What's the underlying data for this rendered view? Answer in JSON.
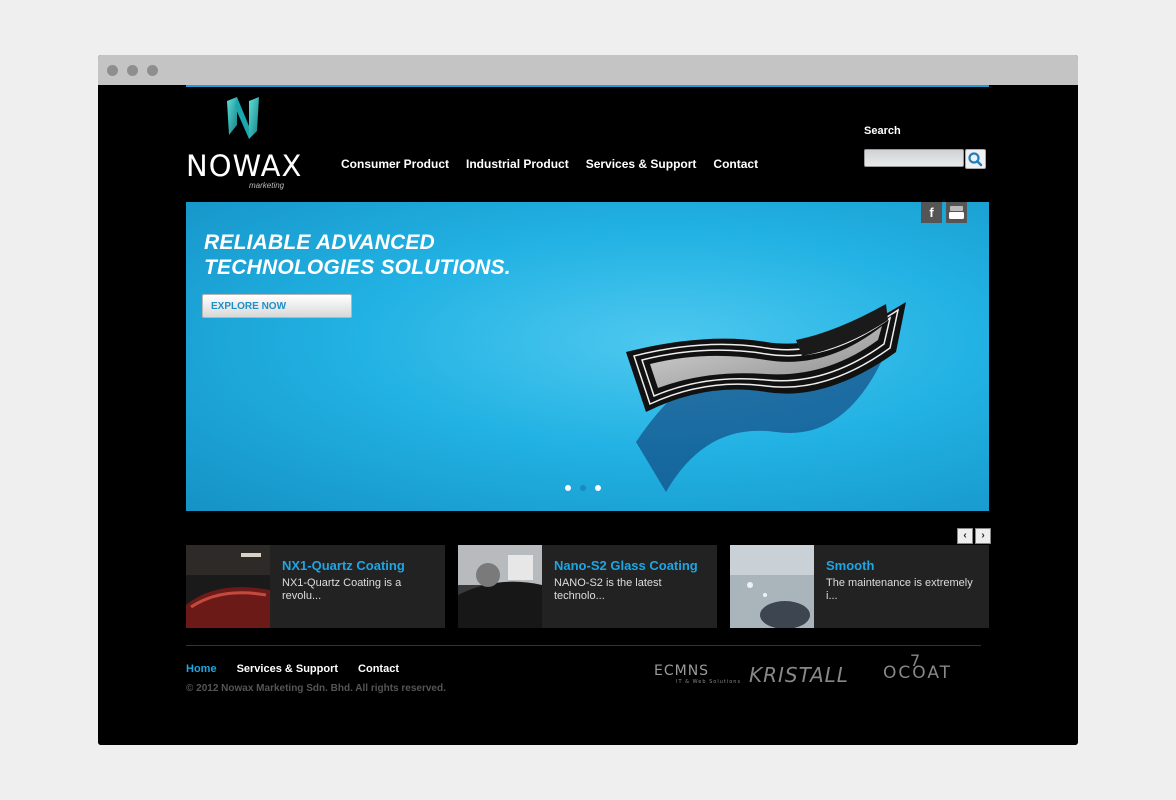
{
  "logo": {
    "name": "NOWAX",
    "sub": "marketing"
  },
  "nav": [
    {
      "label": "Consumer Product"
    },
    {
      "label": "Industrial Product"
    },
    {
      "label": "Services & Support"
    },
    {
      "label": "Contact"
    }
  ],
  "search": {
    "label": "Search",
    "placeholder": "",
    "value": ""
  },
  "hero": {
    "title_line1": "RELIABLE ADVANCED",
    "title_line2": "TECHNOLOGIES SOLUTIONS.",
    "button": "EXPLORE NOW",
    "slide_count": 3,
    "active_slide": 2
  },
  "social": {
    "facebook": "f",
    "youtube": "You Tube"
  },
  "carousel": {
    "prev": "‹",
    "next": "›",
    "items": [
      {
        "title": "NX1-Quartz Coating",
        "desc": "NX1-Quartz Coating is a revolu..."
      },
      {
        "title": "Nano-S2 Glass Coating",
        "desc": "NANO-S2 is the latest technolo..."
      },
      {
        "title": "Smooth",
        "desc": "The maintenance is extremely i..."
      }
    ]
  },
  "footer": {
    "links": [
      {
        "label": "Home"
      },
      {
        "label": "Services & Support"
      },
      {
        "label": "Contact"
      }
    ],
    "copyright": "© 2012 Nowax Marketing Sdn. Bhd. All rights reserved."
  },
  "partners": {
    "ecmns": "ECMNS",
    "ecmns_tag": "IT & Web Solutions",
    "kristall": "KRISTALL",
    "ocoat": "OCOAT",
    "ocoat_mark": "7"
  },
  "colors": {
    "accent": "#1ea5e4",
    "hero_bg": "#22b2e3",
    "page_bg": "#000000"
  }
}
